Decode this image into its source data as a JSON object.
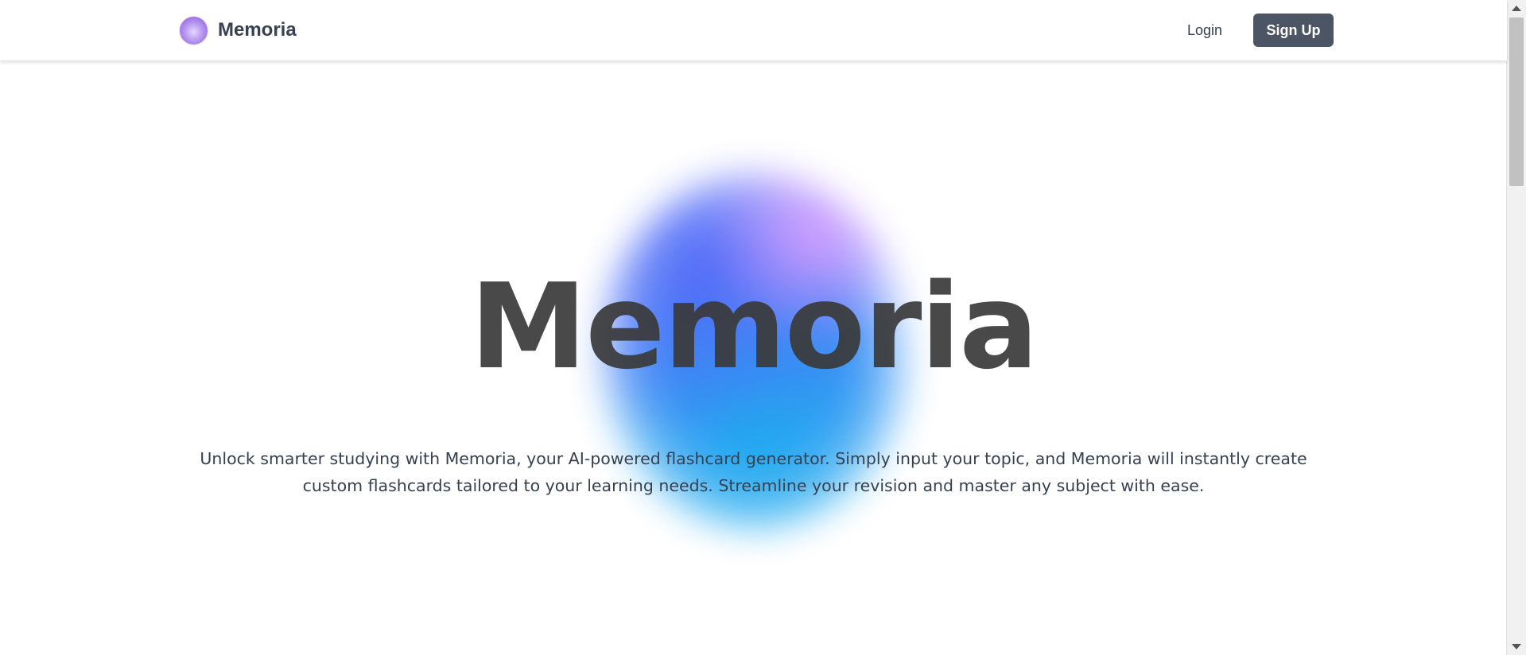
{
  "navbar": {
    "brand_name": "Memoria",
    "logo_icon": "memoria-orb-logo",
    "login_label": "Login",
    "signup_label": "Sign Up"
  },
  "hero": {
    "title": "Memoria",
    "description": "Unlock smarter studying with Memoria, your AI-powered flashcard generator. Simply input your topic, and Memoria will instantly create custom flashcards tailored to your learning needs. Streamline your revision and master any subject with ease."
  },
  "colors": {
    "signup_bg": "#4b5563",
    "text_primary": "#374151",
    "blob_blue": "#3b82f6",
    "blob_cyan": "#12a8ee",
    "blob_purple": "#d296ff"
  }
}
